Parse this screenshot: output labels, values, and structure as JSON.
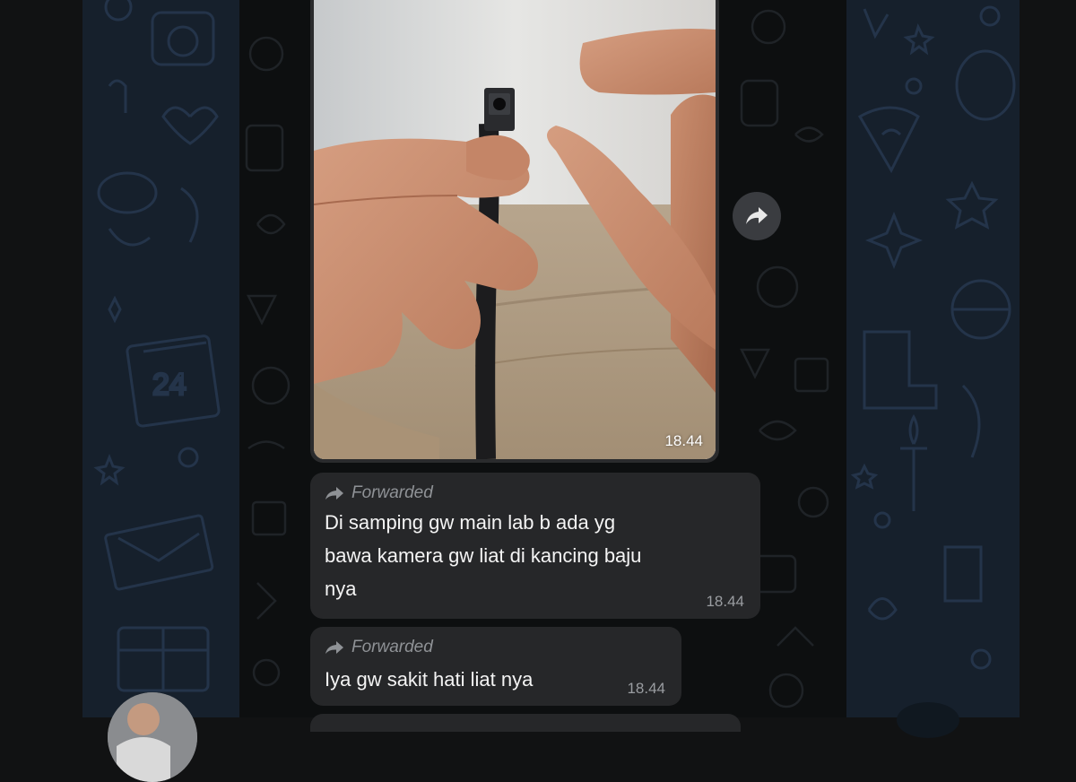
{
  "image_message": {
    "time": "18.44",
    "media_icon": "video-thumbnail"
  },
  "messages": [
    {
      "forward_label": "Forwarded",
      "text": "Di samping gw main lab b ada yg\nbawa kamera gw liat di kancing baju\nnya",
      "time": "18.44"
    },
    {
      "forward_label": "Forwarded",
      "text": "Iya gw sakit hati liat nya",
      "time": "18.44"
    }
  ],
  "icons": {
    "forward_button": "share-forward-icon",
    "forward_label_icon": "forward-arrow-icon"
  },
  "colors": {
    "chat_background": "#0d0f10",
    "bubble": "#262729",
    "side_panel": "#16202c",
    "meta_text": "#9a9da1"
  }
}
